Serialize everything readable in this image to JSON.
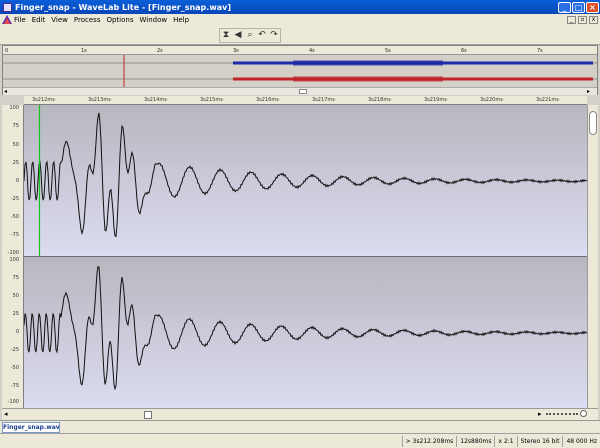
{
  "window": {
    "title": "Finger_snap - WaveLab Lite - [Finger_snap.wav]"
  },
  "menu": [
    "File",
    "Edit",
    "View",
    "Process",
    "Options",
    "Window",
    "Help"
  ],
  "toolbar": {
    "icons": [
      "hourglass-icon",
      "speaker-icon",
      "magnifier-icon",
      "undo-icon",
      "redo-icon"
    ]
  },
  "overview": {
    "ticks": [
      "0",
      "1s",
      "2s",
      "3s",
      "4s",
      "5s",
      "6s",
      "7s"
    ]
  },
  "ruler": {
    "ticks": [
      "3s212ms",
      "3s213ms",
      "3s214ms",
      "3s215ms",
      "3s216ms",
      "3s217ms",
      "3s218ms",
      "3s219ms",
      "3s220ms",
      "3s221ms"
    ]
  },
  "vaxis": {
    "top": [
      "100",
      "75",
      "50",
      "25",
      "0",
      "-25",
      "-50",
      "-75",
      "-100"
    ],
    "bottom": [
      "100",
      "75",
      "50",
      "25",
      "0",
      "-25",
      "-50",
      "-75",
      "-100"
    ]
  },
  "tab": {
    "label": "Finger_snap.wav"
  },
  "status": {
    "position": "> 3s212.208ms",
    "view": "12s880ms",
    "zoom": "x 2:1",
    "format": "Stereo 16 bit",
    "rate": "48 000 Hz"
  },
  "colors": {
    "left_channel": "#1d2ba8",
    "right_channel": "#c0252a",
    "wave_top": "#b7b7bf",
    "wave_bottom": "#dcdcf2",
    "cursor": "#19c21b"
  }
}
